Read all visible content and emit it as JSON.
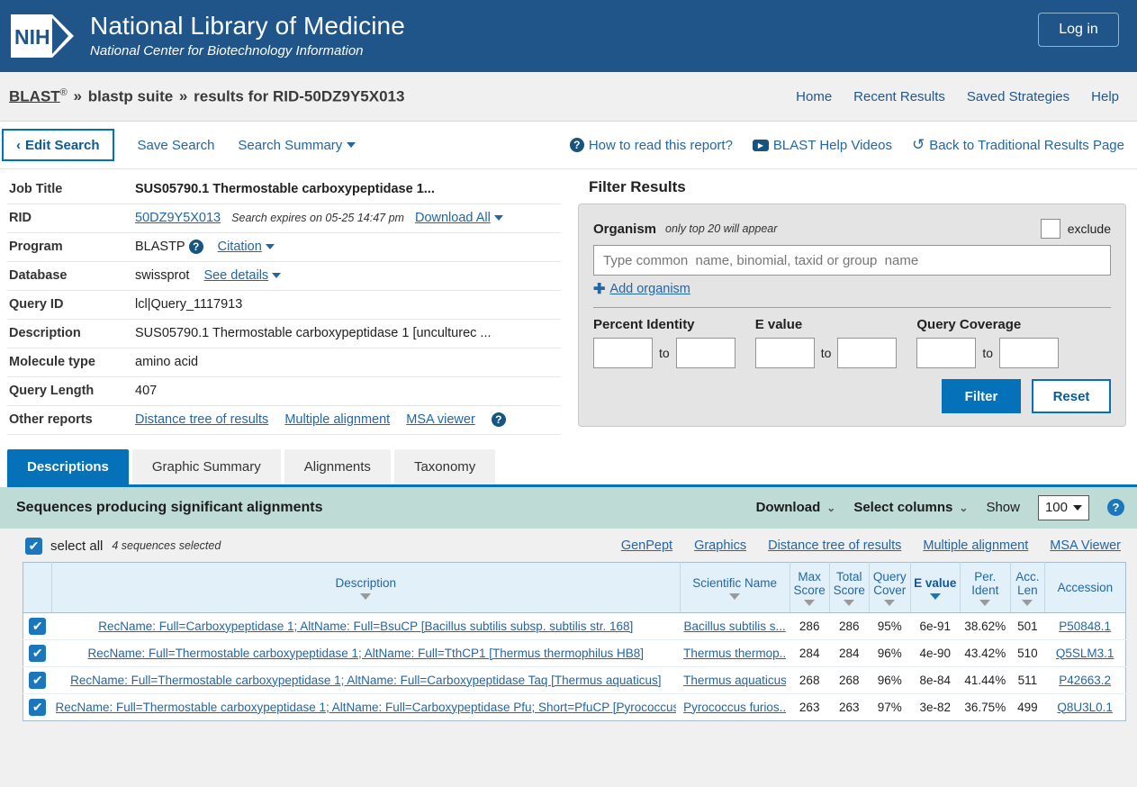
{
  "header": {
    "logo_alt": "NIH",
    "title": "National Library of Medicine",
    "subtitle": "National Center for Biotechnology Information",
    "login_label": "Log in"
  },
  "breadcrumb": {
    "blast": "BLAST",
    "registered_mark": "®",
    "sep": "»",
    "suite": "blastp suite",
    "results": "results for RID-50DZ9Y5X013"
  },
  "top_nav": [
    {
      "label": "Home"
    },
    {
      "label": "Recent Results"
    },
    {
      "label": "Saved Strategies"
    },
    {
      "label": "Help"
    }
  ],
  "action_bar": {
    "edit_search": "Edit Search",
    "back_chevron": "‹",
    "save_search": "Save Search",
    "search_summary": "Search Summary",
    "how_to_read": "How to read this report?",
    "help_videos": "BLAST Help Videos",
    "back_traditional": "Back to Traditional Results Page"
  },
  "job_info": {
    "rows": [
      {
        "key": "Job Title",
        "value": "SUS05790.1 Thermostable carboxypeptidase 1..."
      },
      {
        "key": "RID",
        "value": "50DZ9Y5X013"
      },
      {
        "key": "Program",
        "value": "BLASTP"
      },
      {
        "key": "Database",
        "value": "swissprot"
      },
      {
        "key": "Query ID",
        "value": "lcl|Query_1117913"
      },
      {
        "key": "Description",
        "value": "SUS05790.1 Thermostable carboxypeptidase 1 [unculturec"
      },
      {
        "key": "Molecule type",
        "value": "amino acid"
      },
      {
        "key": "Query Length",
        "value": "407"
      },
      {
        "key": "Other reports",
        "value": ""
      }
    ],
    "rid_expires": "Search expires on 05-25 14:47 pm",
    "download_all": "Download All",
    "citation": "Citation",
    "see_details": "See details",
    "description_ellipsis": "...",
    "other_reports": [
      {
        "label": "Distance tree of results"
      },
      {
        "label": "Multiple alignment"
      },
      {
        "label": "MSA viewer"
      }
    ]
  },
  "filter": {
    "title": "Filter Results",
    "organism_label": "Organism",
    "organism_hint": "only top 20 will appear",
    "exclude_label": "exclude",
    "organism_placeholder": "Type common  name, binomial, taxid or group  name",
    "organism_value": "",
    "add_organism": "Add organism",
    "plus": "✚",
    "percent_identity_label": "Percent Identity",
    "evalue_label": "E value",
    "query_coverage_label": "Query Coverage",
    "to_label": "to",
    "pct_from": "",
    "pct_to": "",
    "eval_from": "",
    "eval_to": "",
    "cov_from": "",
    "cov_to": "",
    "filter_button": "Filter",
    "reset_button": "Reset"
  },
  "tabs": [
    {
      "label": "Descriptions",
      "active": true
    },
    {
      "label": "Graphic Summary",
      "active": false
    },
    {
      "label": "Alignments",
      "active": false
    },
    {
      "label": "Taxonomy",
      "active": false
    }
  ],
  "results_header": {
    "title": "Sequences producing significant alignments",
    "download": "Download",
    "select_columns": "Select columns",
    "show_label": "Show",
    "show_value": "100"
  },
  "selection": {
    "select_all": "select all",
    "count_text": "4 sequences selected",
    "links": [
      {
        "label": "GenPept"
      },
      {
        "label": "Graphics"
      },
      {
        "label": "Distance tree of results"
      },
      {
        "label": "Multiple alignment"
      },
      {
        "label": "MSA Viewer"
      }
    ]
  },
  "table": {
    "columns": [
      {
        "label": "Description",
        "sorted": false
      },
      {
        "label": "Scientific Name",
        "sorted": false
      },
      {
        "label": "Max Score",
        "sorted": false
      },
      {
        "label": "Total Score",
        "sorted": false
      },
      {
        "label": "Query Cover",
        "sorted": false
      },
      {
        "label": "E value",
        "sorted": true
      },
      {
        "label": "Per. Ident",
        "sorted": false
      },
      {
        "label": "Acc. Len",
        "sorted": false
      },
      {
        "label": "Accession",
        "sorted": false
      }
    ],
    "rows": [
      {
        "checked": true,
        "description": "RecName: Full=Carboxypeptidase 1; AltName: Full=BsuCP [Bacillus subtilis subsp. subtilis str. 168]",
        "scientific_name": "Bacillus subtilis s...",
        "max_score": "286",
        "total_score": "286",
        "query_cover": "95%",
        "e_value": "6e-91",
        "per_ident": "38.62%",
        "acc_len": "501",
        "accession": "P50848.1"
      },
      {
        "checked": true,
        "description": "RecName: Full=Thermostable carboxypeptidase 1; AltName: Full=TthCP1 [Thermus thermophilus HB8]",
        "scientific_name": "Thermus thermop...",
        "max_score": "284",
        "total_score": "284",
        "query_cover": "96%",
        "e_value": "4e-90",
        "per_ident": "43.42%",
        "acc_len": "510",
        "accession": "Q5SLM3.1"
      },
      {
        "checked": true,
        "description": "RecName: Full=Thermostable carboxypeptidase 1; AltName: Full=Carboxypeptidase Taq [Thermus aquaticus]",
        "scientific_name": "Thermus aquaticus",
        "max_score": "268",
        "total_score": "268",
        "query_cover": "96%",
        "e_value": "8e-84",
        "per_ident": "41.44%",
        "acc_len": "511",
        "accession": "P42663.2"
      },
      {
        "checked": true,
        "description": "RecName: Full=Thermostable carboxypeptidase 1; AltName: Full=Carboxypeptidase Pfu; Short=PfuCP [Pyrococcus f...",
        "scientific_name": "Pyrococcus furios...",
        "max_score": "263",
        "total_score": "263",
        "query_cover": "97%",
        "e_value": "3e-82",
        "per_ident": "36.75%",
        "acc_len": "499",
        "accession": "Q8U3L0.1"
      }
    ]
  },
  "colors": {
    "nih_blue": "#20558a",
    "accent_blue": "#0571b9",
    "link_blue": "#2266a5",
    "results_header_bg": "#bfdbd6",
    "table_header_bg": "#e2f0fa"
  },
  "glyphs": {
    "check": "✔",
    "chevron_down": "⌄",
    "question": "?",
    "play": "▶",
    "undo": "↺"
  }
}
